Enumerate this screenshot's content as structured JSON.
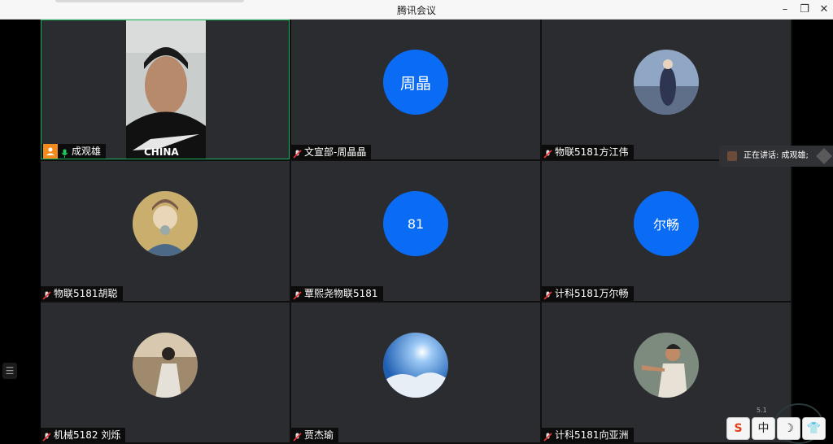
{
  "window": {
    "title": "腾讯会议"
  },
  "speaking": {
    "label": "正在讲话: 成观雄;"
  },
  "network": {
    "rate": "5.1"
  },
  "ime": {
    "logo": "S",
    "mode": "中",
    "moon": "☽",
    "shirt": "👕"
  },
  "tiles": [
    {
      "name": "成观雄",
      "type": "video"
    },
    {
      "name": "文宣部-周晶晶",
      "avatar_text": "周晶",
      "avatar_color": "#0a6cf5"
    },
    {
      "name": "物联5181方江伟",
      "type": "photo"
    },
    {
      "name": "物联5181胡聪",
      "type": "photo"
    },
    {
      "name": "覃熙尧物联5181",
      "avatar_text": "81",
      "avatar_color": "#0a6cf5"
    },
    {
      "name": "计科5181万尔畅",
      "avatar_text": "尔畅",
      "avatar_color": "#0a6cf5"
    },
    {
      "name": "机械5182 刘烁",
      "type": "photo"
    },
    {
      "name": "贾杰瑜",
      "type": "photo"
    },
    {
      "name": "计科5181向亚洲",
      "type": "photo"
    }
  ],
  "colors": {
    "tile_bg": "#2b2c30",
    "avatar_blue": "#0a6cf5",
    "active_border": "#18b35a",
    "host_badge": "#f28b1c"
  }
}
